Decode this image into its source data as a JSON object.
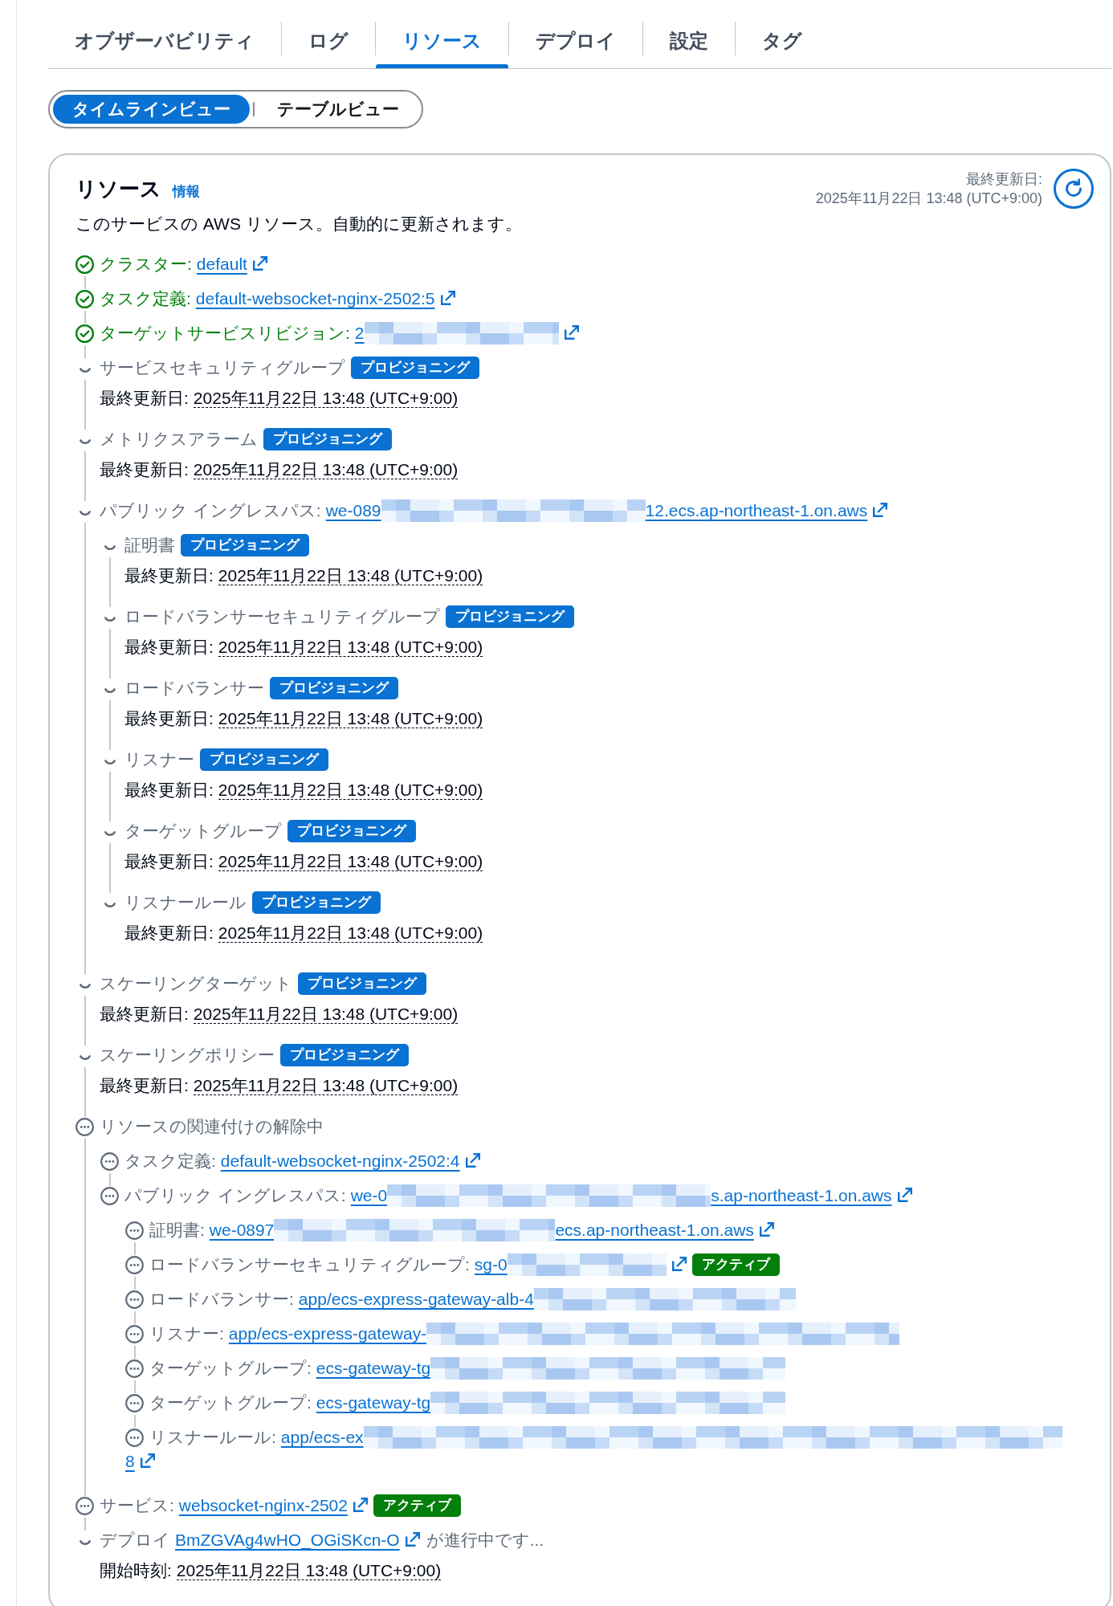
{
  "tabs": [
    {
      "label": "オブザーバビリティ",
      "selected": false
    },
    {
      "label": "ログ",
      "selected": false
    },
    {
      "label": "リソース",
      "selected": true
    },
    {
      "label": "デプロイ",
      "selected": false
    },
    {
      "label": "設定",
      "selected": false
    },
    {
      "label": "タグ",
      "selected": false
    }
  ],
  "view_toggle": [
    {
      "label": "タイムラインビュー",
      "selected": true
    },
    {
      "label": "テーブルビュー",
      "selected": false
    }
  ],
  "resources": {
    "title": "リソース",
    "info_link": "情報",
    "description": "このサービスの AWS リソース。自動的に更新されます。",
    "last_updated": {
      "label": "最終更新日:",
      "value": "2025年11月22日 13:48 (UTC+9:00)"
    },
    "items": [
      {
        "kind": "success",
        "label": "クラスター:",
        "link": {
          "text": "default",
          "redacted": false,
          "external": true
        }
      },
      {
        "kind": "success",
        "label": "タスク定義:",
        "link": {
          "text": "default-websocket-nginx-2502:5",
          "redacted": false,
          "external": true
        }
      },
      {
        "kind": "success",
        "label": "ターゲットサービスリビジョン:",
        "link": {
          "text": "2",
          "redacted": true,
          "external": true
        }
      },
      {
        "kind": "in_progress",
        "label": "サービスセキュリティグループ",
        "badge": {
          "text": "プロビジョニング",
          "kind": "info"
        },
        "detail": {
          "label": "最終更新日:",
          "value": "2025年11月22日 13:48 (UTC+9:00)"
        }
      },
      {
        "kind": "in_progress",
        "label": "メトリクスアラーム",
        "badge": {
          "text": "プロビジョニング",
          "kind": "info"
        },
        "detail": {
          "label": "最終更新日:",
          "value": "2025年11月22日 13:48 (UTC+9:00)"
        }
      },
      {
        "kind": "in_progress",
        "label": "パブリック イングレスパス:",
        "link": {
          "text": "we-089",
          "redacted": true,
          "text_after": "12.ecs.ap-northeast-1.on.aws",
          "external": true
        },
        "children": [
          {
            "kind": "in_progress",
            "label": "証明書",
            "badge": {
              "text": "プロビジョニング",
              "kind": "info"
            },
            "detail": {
              "label": "最終更新日:",
              "value": "2025年11月22日 13:48 (UTC+9:00)"
            }
          },
          {
            "kind": "in_progress",
            "label": "ロードバランサーセキュリティグループ",
            "badge": {
              "text": "プロビジョニング",
              "kind": "info"
            },
            "detail": {
              "label": "最終更新日:",
              "value": "2025年11月22日 13:48 (UTC+9:00)"
            }
          },
          {
            "kind": "in_progress",
            "label": "ロードバランサー",
            "badge": {
              "text": "プロビジョニング",
              "kind": "info"
            },
            "detail": {
              "label": "最終更新日:",
              "value": "2025年11月22日 13:48 (UTC+9:00)"
            }
          },
          {
            "kind": "in_progress",
            "label": "リスナー",
            "badge": {
              "text": "プロビジョニング",
              "kind": "info"
            },
            "detail": {
              "label": "最終更新日:",
              "value": "2025年11月22日 13:48 (UTC+9:00)"
            }
          },
          {
            "kind": "in_progress",
            "label": "ターゲットグループ",
            "badge": {
              "text": "プロビジョニング",
              "kind": "info"
            },
            "detail": {
              "label": "最終更新日:",
              "value": "2025年11月22日 13:48 (UTC+9:00)"
            }
          },
          {
            "kind": "in_progress",
            "label": "リスナールール",
            "badge": {
              "text": "プロビジョニング",
              "kind": "info"
            },
            "detail": {
              "label": "最終更新日:",
              "value": "2025年11月22日 13:48 (UTC+9:00)"
            }
          }
        ]
      },
      {
        "kind": "in_progress",
        "label": "スケーリングターゲット",
        "badge": {
          "text": "プロビジョニング",
          "kind": "info"
        },
        "detail": {
          "label": "最終更新日:",
          "value": "2025年11月22日 13:48 (UTC+9:00)"
        }
      },
      {
        "kind": "in_progress",
        "label": "スケーリングポリシー",
        "badge": {
          "text": "プロビジョニング",
          "kind": "info"
        },
        "detail": {
          "label": "最終更新日:",
          "value": "2025年11月22日 13:48 (UTC+9:00)"
        }
      },
      {
        "kind": "pending",
        "label": "リソースの関連付けの解除中",
        "children": [
          {
            "kind": "pending",
            "label": "タスク定義:",
            "link": {
              "text": "default-websocket-nginx-2502:4",
              "redacted": false,
              "external": true
            }
          },
          {
            "kind": "pending",
            "label": "パブリック イングレスパス:",
            "link": {
              "text": "we-0",
              "redacted": true,
              "text_after": "s.ap-northeast-1.on.aws",
              "external": true
            },
            "children": [
              {
                "kind": "pending",
                "label": "証明書:",
                "link": {
                  "text": "we-0897",
                  "redacted": true,
                  "text_after": "ecs.ap-northeast-1.on.aws",
                  "external": true
                }
              },
              {
                "kind": "pending",
                "label": "ロードバランサーセキュリティグループ:",
                "link": {
                  "text": "sg-0",
                  "redacted": true,
                  "external": true
                },
                "badge": {
                  "text": "アクティブ",
                  "kind": "success"
                }
              },
              {
                "kind": "pending",
                "label": "ロードバランサー:",
                "link": {
                  "text": "app/ecs-express-gateway-alb-4",
                  "redacted": true,
                  "external": false
                }
              },
              {
                "kind": "pending",
                "label": "リスナー:",
                "link": {
                  "text": "app/ecs-express-gateway-",
                  "redacted": true,
                  "external": false
                }
              },
              {
                "kind": "pending",
                "label": "ターゲットグループ:",
                "link": {
                  "text": "ecs-gateway-tg",
                  "redacted": true,
                  "external": false
                }
              },
              {
                "kind": "pending",
                "label": "ターゲットグループ:",
                "link": {
                  "text": "ecs-gateway-tg",
                  "redacted": true,
                  "external": false
                }
              },
              {
                "kind": "pending",
                "label": "リスナールール:",
                "link": {
                  "text": "app/ecs-ex",
                  "redacted": true,
                  "text_after": "8",
                  "external": true
                }
              }
            ]
          }
        ]
      },
      {
        "kind": "pending",
        "label": "サービス:",
        "link": {
          "text": "websocket-nginx-2502",
          "redacted": false,
          "external": true
        },
        "badge": {
          "text": "アクティブ",
          "kind": "success"
        }
      },
      {
        "kind": "in_progress",
        "label": "デプロイ",
        "link": {
          "text": "BmZGVAg4wHO_OGiSKcn-O",
          "redacted": false,
          "external": true
        },
        "suffix": "が進行中です...",
        "detail": {
          "label": "開始時刻:",
          "value": "2025年11月22日 13:48 (UTC+9:00)"
        }
      }
    ]
  }
}
